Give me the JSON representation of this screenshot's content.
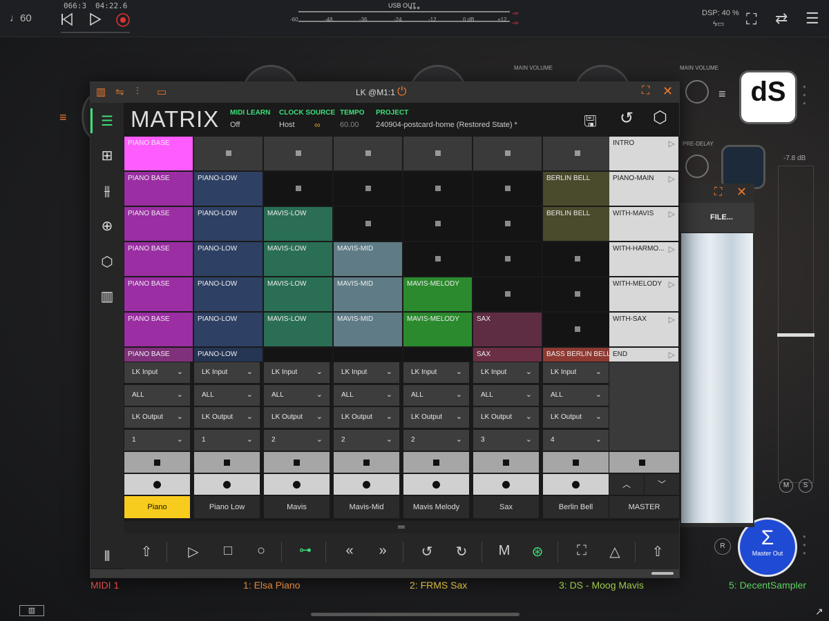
{
  "topbar": {
    "tempo": "♩60",
    "bars": "066:3",
    "time": "04:22.6",
    "meter_title": "USB OUT",
    "meter_ticks": [
      "-60",
      "-48",
      "-36",
      "-24",
      "-12",
      "0 dB",
      "+12"
    ],
    "meter_inf": "-∞",
    "dsp": "DSP: 40 %"
  },
  "background": {
    "main_volume_1": "MAIN VOLUME",
    "main_volume_2": "MAIN VOLUME",
    "pre_delay": "PRE-DELAY",
    "db_value": "-7.8 dB",
    "file_label": "FILE...",
    "ds_logo": "dS",
    "m": "M",
    "s": "S",
    "r": "R",
    "master_out": "Master Out"
  },
  "window": {
    "title": "LK @M1:1"
  },
  "header": {
    "app_name": "MATRIX",
    "midi_learn_label": "MIDI LEARN",
    "midi_learn_value": "Off",
    "clock_label": "CLOCK SOURCE",
    "clock_value": "Host",
    "tempo_label": "TEMPO",
    "tempo_value": "60.00",
    "project_label": "PROJECT",
    "project_value": "240904-postcard-home (Restored State) *"
  },
  "clips": [
    [
      "PIANO BASE",
      "",
      "",
      "",
      "",
      "",
      ""
    ],
    [
      "PIANO BASE",
      "PIANO-LOW",
      "",
      "",
      "",
      "",
      "BERLIN BELL"
    ],
    [
      "PIANO BASE",
      "PIANO-LOW",
      "MAVIS-LOW",
      "",
      "",
      "",
      "BERLIN BELL"
    ],
    [
      "PIANO BASE",
      "PIANO-LOW",
      "MAVIS-LOW",
      "MAVIS-MID",
      "",
      "",
      ""
    ],
    [
      "PIANO BASE",
      "PIANO-LOW",
      "MAVIS-LOW",
      "MAVIS-MID",
      "MAVIS-MELODY",
      "",
      ""
    ],
    [
      "PIANO BASE",
      "PIANO-LOW",
      "MAVIS-LOW",
      "MAVIS-MID",
      "MAVIS-MELODY",
      "SAX",
      ""
    ],
    [
      "PIANO BASE",
      "PIANO-LOW",
      "",
      "",
      "",
      "SAX",
      "BASS BERLIN BELL"
    ]
  ],
  "clip_colors": [
    "#9a2ea2",
    "#2e4164",
    "#2a6e55",
    "#5f7c86",
    "#2b8a2e",
    "#5e2d44",
    "#4a4a2c"
  ],
  "clip_colors_last": [
    "#80317c",
    "#253554",
    "",
    "",
    "",
    "#6b2f45",
    "#8e3a32"
  ],
  "active_clip_color": "#ff5cff",
  "scenes": [
    "INTRO",
    "PIANO-MAIN",
    "WITH-MAVIS",
    "WITH-HARMO...",
    "WITH-MELODY",
    "WITH-SAX",
    "END"
  ],
  "tracks": [
    {
      "input": "LK Input",
      "filter": "ALL",
      "output": "LK Output",
      "channel": "1",
      "name": "Piano"
    },
    {
      "input": "LK Input",
      "filter": "ALL",
      "output": "LK Output",
      "channel": "1",
      "name": "Piano Low"
    },
    {
      "input": "LK Input",
      "filter": "ALL",
      "output": "LK Output",
      "channel": "2",
      "name": "Mavis"
    },
    {
      "input": "LK Input",
      "filter": "ALL",
      "output": "LK Output",
      "channel": "2",
      "name": "Mavis-Mid"
    },
    {
      "input": "LK Input",
      "filter": "ALL",
      "output": "LK Output",
      "channel": "2",
      "name": "Mavis Melody"
    },
    {
      "input": "LK Input",
      "filter": "ALL",
      "output": "LK Output",
      "channel": "3",
      "name": "Sax"
    },
    {
      "input": "LK Input",
      "filter": "ALL",
      "output": "LK Output",
      "channel": "4",
      "name": "Berlin Bell"
    }
  ],
  "master": "MASTER",
  "selected_track_color": "#f8cc1c",
  "bottom_tracks": {
    "t0": "MIDI 1",
    "t1": "1: Elsa Piano",
    "t2": "2: FRMS Sax",
    "t3": "3: DS - Moog Mavis",
    "t4": "5: DecentSampler"
  }
}
